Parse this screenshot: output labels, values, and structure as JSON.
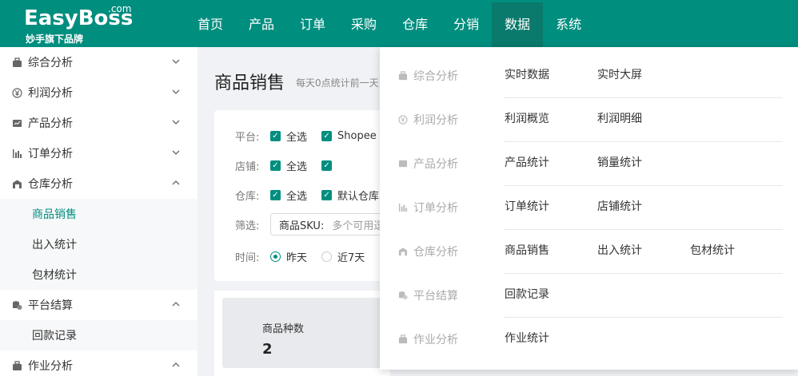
{
  "brand": {
    "name": "EasyBoss",
    "com": ".com",
    "tagline": "妙手旗下品牌"
  },
  "nav": [
    "首页",
    "产品",
    "订单",
    "采购",
    "仓库",
    "分销",
    "数据",
    "系统"
  ],
  "nav_active": "数据",
  "sidebar": {
    "groups": [
      {
        "label": "综合分析",
        "icon": "briefcase-icon",
        "expanded": false,
        "items": []
      },
      {
        "label": "利润分析",
        "icon": "yen-icon",
        "expanded": false,
        "items": []
      },
      {
        "label": "产品分析",
        "icon": "chart-card-icon",
        "expanded": false,
        "items": []
      },
      {
        "label": "订单分析",
        "icon": "bar-chart-icon",
        "expanded": false,
        "items": []
      },
      {
        "label": "仓库分析",
        "icon": "warehouse-icon",
        "expanded": true,
        "items": [
          "商品销售",
          "出入统计",
          "包材统计"
        ]
      },
      {
        "label": "平台结算",
        "icon": "coins-icon",
        "expanded": true,
        "items": [
          "回款记录"
        ]
      },
      {
        "label": "作业分析",
        "icon": "briefcase-icon",
        "expanded": true,
        "items": []
      }
    ],
    "active_item": "商品销售"
  },
  "main": {
    "title": "商品销售",
    "subtitle": "每天0点统计前一天",
    "filters": {
      "platform_label": "平台:",
      "platform_all": "全选",
      "platform_opt": "Shopee",
      "shop_label": "店铺:",
      "shop_all": "全选",
      "shop_opt": "",
      "warehouse_label": "仓库:",
      "warehouse_all": "全选",
      "warehouse_opt": "默认仓库",
      "screen_label": "筛选:",
      "sku_label": "商品SKU:",
      "sku_placeholder": "多个可用逗",
      "time_label": "时间:",
      "time_yesterday": "昨天",
      "time_7days": "近7天"
    },
    "stats": {
      "label": "商品种数",
      "value": "2"
    }
  },
  "dropdown": {
    "rows": [
      {
        "category": "综合分析",
        "icon": "briefcase-icon",
        "links": [
          "实时数据",
          "实时大屏"
        ]
      },
      {
        "category": "利润分析",
        "icon": "yen-icon",
        "links": [
          "利润概览",
          "利润明细"
        ]
      },
      {
        "category": "产品分析",
        "icon": "chart-card-icon",
        "links": [
          "产品统计",
          "销量统计"
        ]
      },
      {
        "category": "订单分析",
        "icon": "bar-chart-icon",
        "links": [
          "订单统计",
          "店铺统计"
        ]
      },
      {
        "category": "仓库分析",
        "icon": "warehouse-icon",
        "links": [
          "商品销售",
          "出入统计",
          "包材统计"
        ]
      },
      {
        "category": "平台结算",
        "icon": "coins-icon",
        "links": [
          "回款记录"
        ]
      },
      {
        "category": "作业分析",
        "icon": "briefcase-icon",
        "links": [
          "作业统计"
        ]
      }
    ]
  },
  "colors": {
    "brand": "#008e7f",
    "nav_active": "#0a7a6d"
  }
}
